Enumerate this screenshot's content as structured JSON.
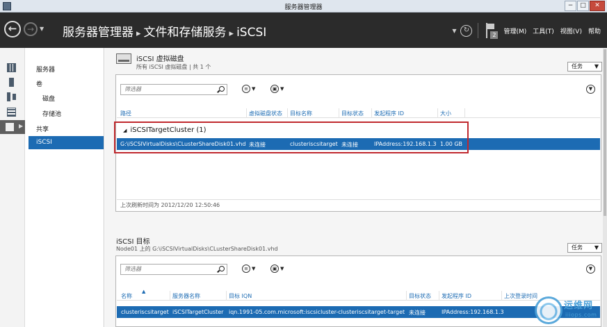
{
  "window": {
    "title": "服务器管理器",
    "min": "−",
    "max": "□",
    "close": "✕"
  },
  "header": {
    "crumb1": "服务器管理器",
    "crumb2": "文件和存储服务",
    "crumb3": "iSCSI",
    "sep": "▸",
    "badge": "2",
    "menu_manage": "管理(M)",
    "menu_tools": "工具(T)",
    "menu_view": "视图(V)",
    "menu_help": "帮助"
  },
  "leftnav": {
    "items": [
      "服务器",
      "卷",
      "磁盘",
      "存储池",
      "共享",
      "iSCSI"
    ]
  },
  "vdisks": {
    "title": "iSCSI 虚拟磁盘",
    "subtitle": "所有 iSCSI 虚拟磁盘 | 共 1 个",
    "tasks": "任务",
    "filter_placeholder": "筛选器",
    "columns": [
      "路径",
      "虚拟磁盘状态",
      "目标名称",
      "目标状态",
      "发起程序 ID",
      "大小"
    ],
    "group": "iSCSITargetCluster (1)",
    "row": {
      "path": "G:\\iSCSIVirtualDisks\\CLusterShareDisk01.vhd",
      "disk_status": "未连接",
      "target_name": "clusteriscsitarget",
      "target_status": "未连接",
      "initiator": "IPAddress:192.168.1.3",
      "size": "1.00 GB"
    },
    "refresh": "上次刷新时间为 2012/12/20 12:50:46"
  },
  "targets": {
    "title": "iSCSI 目标",
    "subtitle": "Node01 上的 G:\\iSCSIVirtualDisks\\CLusterShareDisk01.vhd",
    "tasks": "任务",
    "filter_placeholder": "筛选器",
    "columns": [
      "名称",
      "服务器名称",
      "目标 IQN",
      "目标状态",
      "发起程序 ID",
      "上次登录时间"
    ],
    "row": {
      "name": "clusteriscsitarget",
      "server": "iSCSITargetCluster",
      "iqn": "iqn.1991-05.com.microsoft:iscsicluster-clusteriscsitarget-target",
      "status": "未连接",
      "initiator": "IPAddress:192.168.1.3"
    }
  },
  "watermark": {
    "line1": "运维网",
    "line2": "iiiops.com"
  }
}
